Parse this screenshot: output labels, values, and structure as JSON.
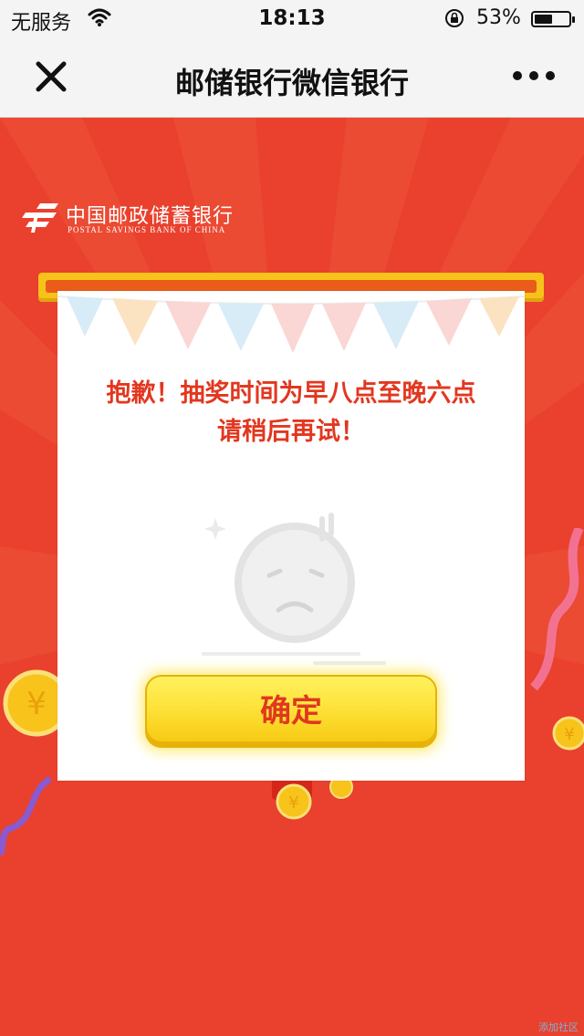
{
  "status_bar": {
    "carrier": "无服务",
    "time": "18:13",
    "battery_percent": "53%",
    "battery_level": 0.53,
    "icons": [
      "wifi-icon",
      "rotation-lock-icon",
      "battery-icon"
    ]
  },
  "nav": {
    "title": "邮储银行微信银行",
    "close_icon": "close-icon",
    "more_icon": "more-dots-icon"
  },
  "logo": {
    "name_cn": "中国邮政储蓄银行",
    "name_en": "POSTAL SAVINGS BANK OF CHINA"
  },
  "dialog": {
    "message_line1": "抱歉！抽奖时间为早八点至晚六点",
    "message_line2": "请稍后再试！",
    "confirm_label": "确定"
  },
  "watermark": "添加社区",
  "colors": {
    "background": "#e9412d",
    "accent_red": "#e2371f",
    "button_yellow": "#fde23a",
    "gold_rod": "#f7c21a"
  }
}
